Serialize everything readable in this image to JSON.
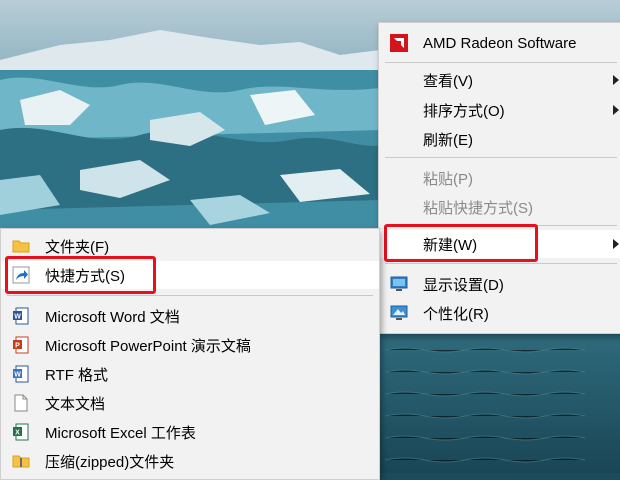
{
  "main_menu": {
    "items": [
      {
        "label": "AMD Radeon Software",
        "icon": "amd-radeon-icon"
      },
      {
        "label": "查看(V)"
      },
      {
        "label": "排序方式(O)"
      },
      {
        "label": "刷新(E)"
      },
      {
        "label": "粘贴(P)",
        "disabled": true
      },
      {
        "label": "粘贴快捷方式(S)",
        "disabled": true
      },
      {
        "label": "新建(W)",
        "highlighted": true
      },
      {
        "label": "显示设置(D)",
        "icon": "display-settings-icon"
      },
      {
        "label": "个性化(R)",
        "icon": "personalize-icon"
      }
    ]
  },
  "new_submenu": {
    "items": [
      {
        "label": "文件夹(F)",
        "icon": "folder-icon"
      },
      {
        "label": "快捷方式(S)",
        "icon": "shortcut-icon",
        "highlighted": true
      },
      {
        "label": "Microsoft Word 文档",
        "icon": "word-doc-icon"
      },
      {
        "label": "Microsoft PowerPoint 演示文稿",
        "icon": "powerpoint-icon"
      },
      {
        "label": "RTF 格式",
        "icon": "rtf-doc-icon"
      },
      {
        "label": "文本文档",
        "icon": "text-doc-icon"
      },
      {
        "label": "Microsoft Excel 工作表",
        "icon": "excel-icon"
      },
      {
        "label": "压缩(zipped)文件夹",
        "icon": "zip-folder-icon"
      }
    ]
  },
  "colors": {
    "menu_bg": "#f2f2f2",
    "highlight_box": "#e8101c",
    "amd_red": "#d4141c"
  }
}
